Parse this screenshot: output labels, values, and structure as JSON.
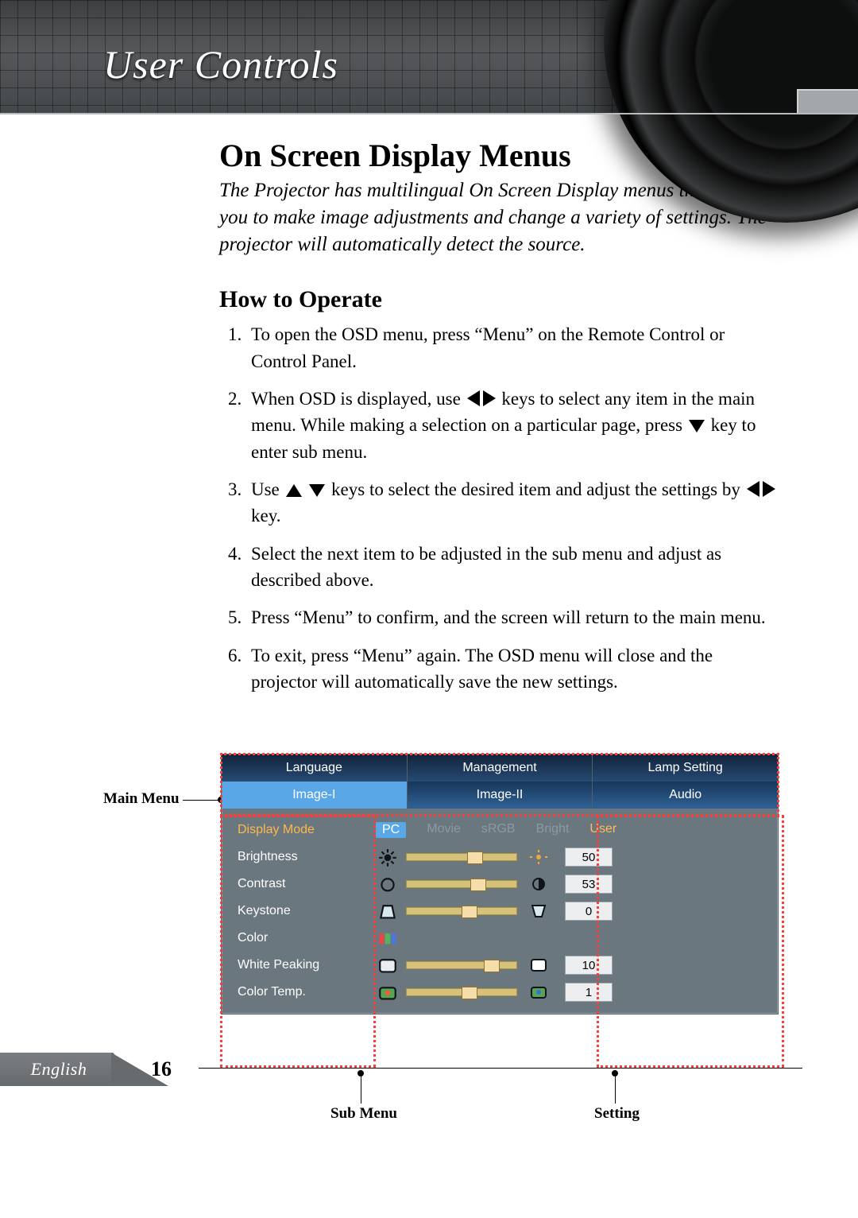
{
  "header": {
    "title": "User Controls"
  },
  "sect": {
    "h2": "On Screen Display Menus",
    "intro": "The Projector has multilingual On Screen Display menus that allow you to make image adjustments and change a variety of settings. The projector will automatically detect the source.",
    "h3": "How to Operate",
    "steps": {
      "s1": "To open the OSD menu, press “Menu” on the Remote Control or Control Panel.",
      "s2a": "When OSD is displayed, use ",
      "s2b": " keys to select any item in the main menu.  While making a selection on a particular page, press ",
      "s2c": " key to enter sub menu.",
      "s3a": "Use ",
      "s3b": " keys to select the desired item and adjust the settings by ",
      "s3c": " key.",
      "s4": "Select the next item to be adjusted in the sub menu and adjust as described above.",
      "s5": "Press “Menu” to confirm, and the screen will return to the main menu.",
      "s6": "To exit, press “Menu” again.  The OSD menu will close and the projector will automatically save the new settings."
    }
  },
  "labels": {
    "main": "Main Menu",
    "sub": "Sub Menu",
    "setting": "Setting"
  },
  "osd": {
    "top": [
      "Language",
      "Management",
      "Lamp Setting"
    ],
    "bot": [
      "Image-I",
      "Image-II",
      "Audio"
    ],
    "botSelIndex": 0,
    "modes": [
      "PC",
      "Movie",
      "sRGB",
      "Bright",
      "User"
    ],
    "modeSelIndex": 0,
    "rows": [
      {
        "label": "Display Mode",
        "selected": true,
        "kind": "modes"
      },
      {
        "label": "Brightness",
        "kind": "slider",
        "value": 50,
        "pct": 55
      },
      {
        "label": "Contrast",
        "kind": "slider",
        "value": 53,
        "pct": 58
      },
      {
        "label": "Keystone",
        "kind": "slider",
        "value": 0,
        "pct": 50
      },
      {
        "label": "Color",
        "kind": "icon-only"
      },
      {
        "label": "White Peaking",
        "kind": "slider",
        "value": 10,
        "pct": 70
      },
      {
        "label": "Color Temp.",
        "kind": "slider",
        "value": 1,
        "pct": 50
      }
    ]
  },
  "footer": {
    "lang": "English",
    "page": "16"
  }
}
